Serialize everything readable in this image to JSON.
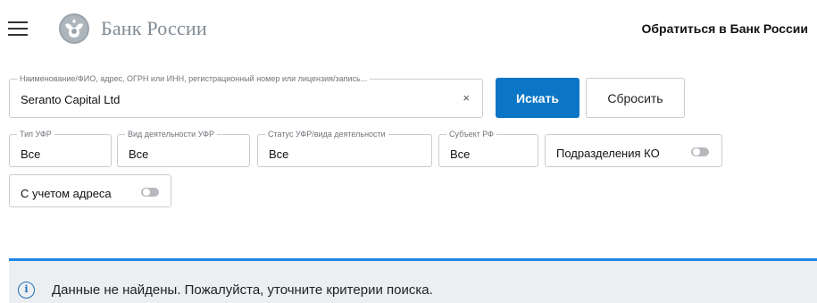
{
  "header": {
    "brand": "Банк России",
    "contact_link": "Обратиться в Банк России",
    "menu_icon": "hamburger-menu-icon",
    "logo_icon": "double-headed-eagle-emblem"
  },
  "search": {
    "label": "Наименование/ФИО, адрес, ОГРН или ИНН, регистрационный номер или лицензия/запись...",
    "value": "Seranto Capital Ltd",
    "clear_icon": "×",
    "search_button": "Искать",
    "reset_button": "Сбросить"
  },
  "filters": {
    "ufr_type": {
      "label": "Тип УФР",
      "value": "Все"
    },
    "activity_type": {
      "label": "Вид деятельности УФР",
      "value": "Все"
    },
    "status": {
      "label": "Статус УФР/вида деятельности",
      "value": "Все"
    },
    "region": {
      "label": "Субъект РФ",
      "value": "Все"
    },
    "ko_divisions": {
      "label": "Подразделения КО",
      "enabled": false
    },
    "with_address": {
      "label": "С учетом адреса",
      "enabled": false
    }
  },
  "message": {
    "icon": "info-icon",
    "text": "Данные не найдены. Пожалуйста, уточните критерии поиска."
  },
  "colors": {
    "primary": "#0a76c5",
    "alert_bar": "#1e88e5",
    "alert_bg": "#eceff2",
    "brand_text": "#7f8a93"
  }
}
